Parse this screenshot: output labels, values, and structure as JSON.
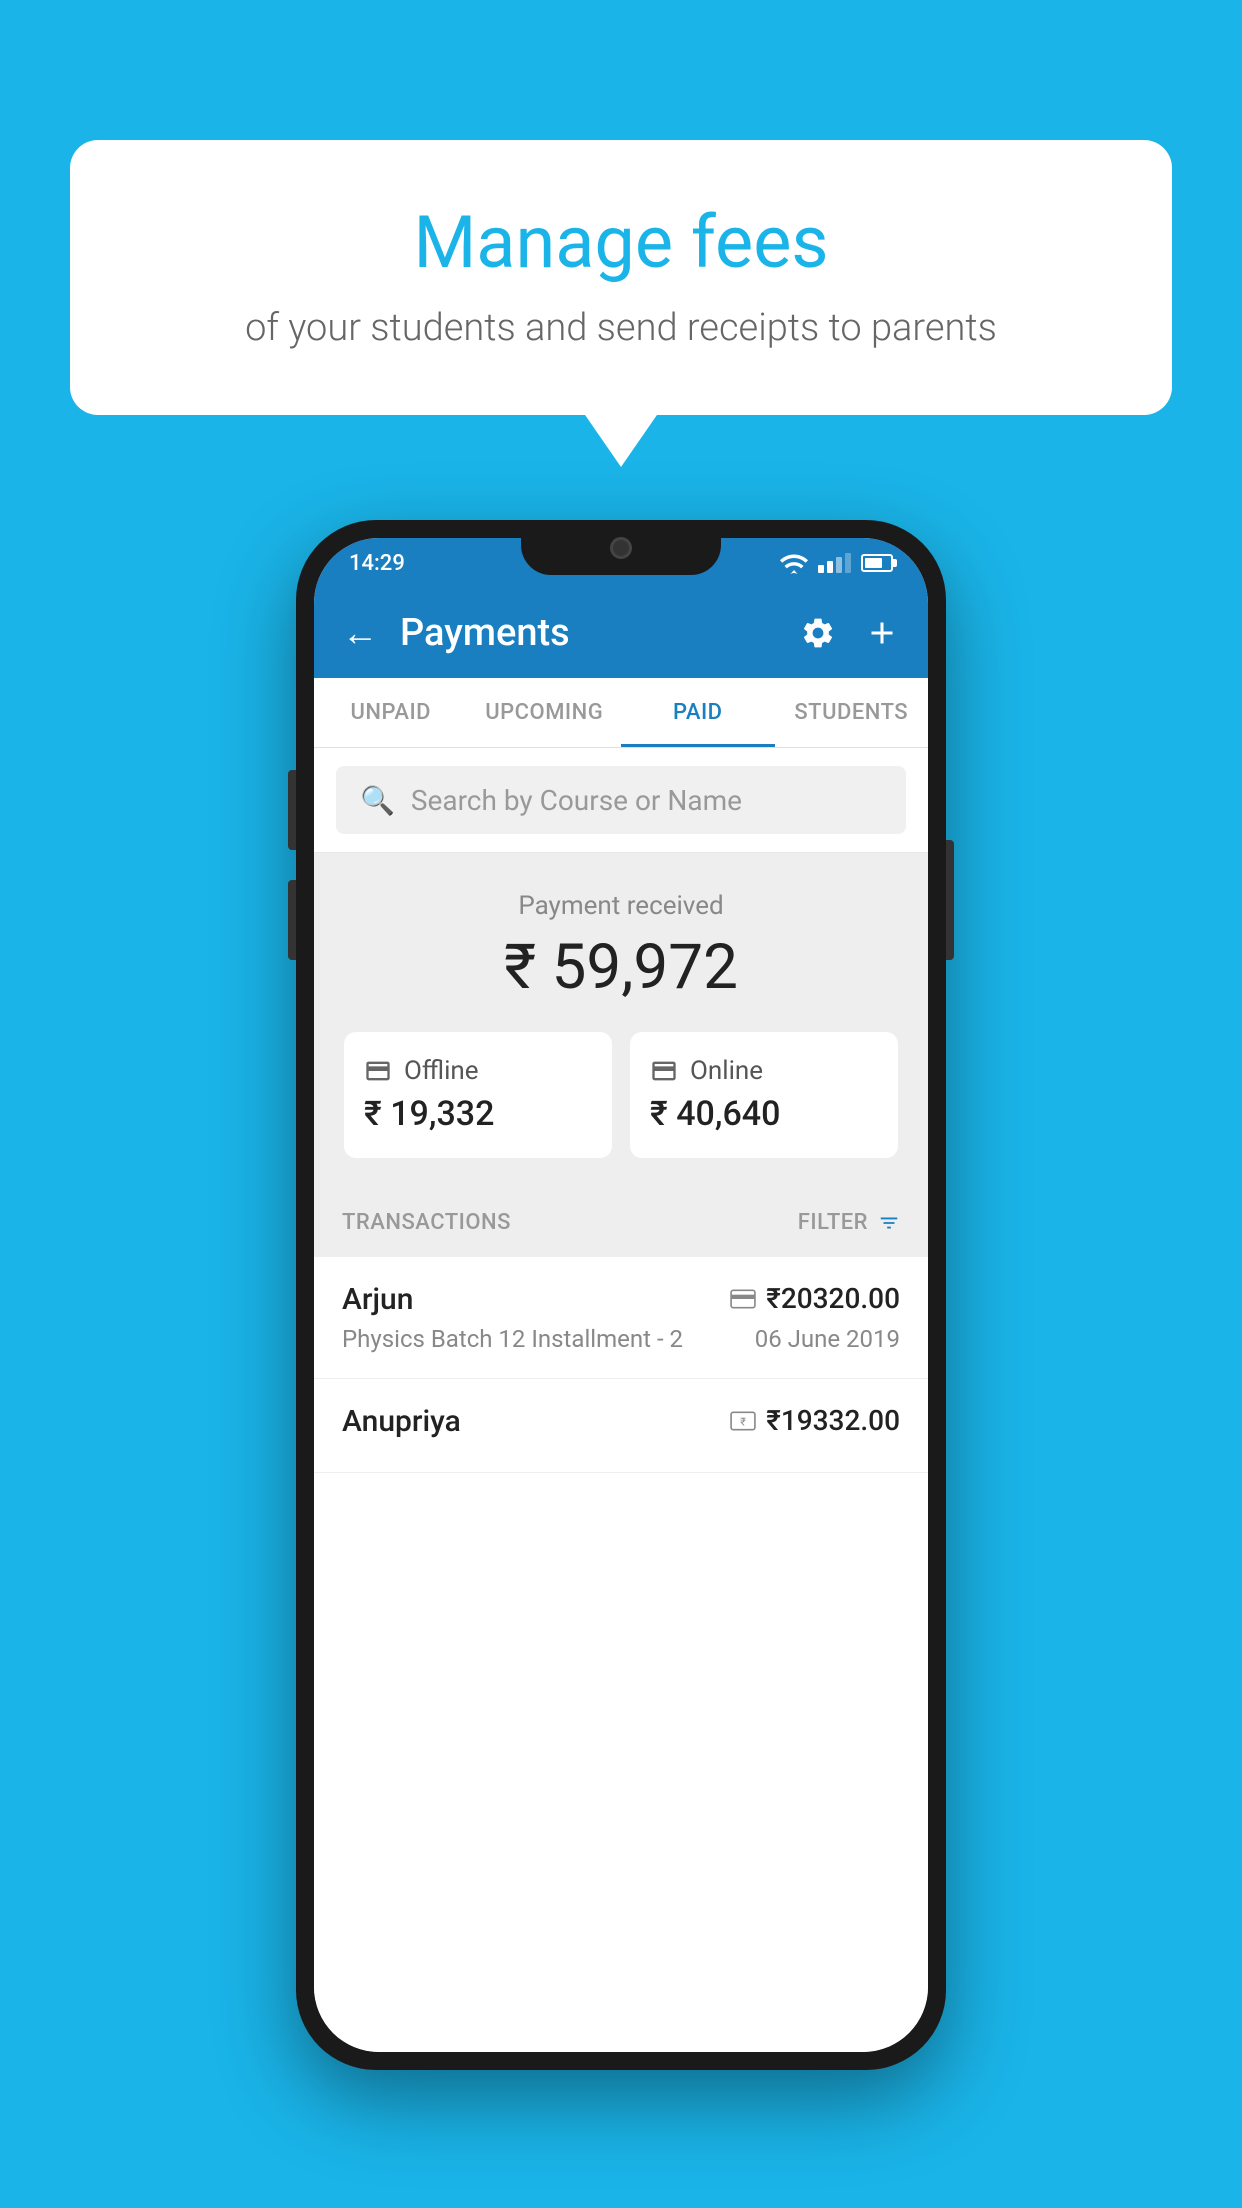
{
  "background_color": "#1ab4e8",
  "speech_bubble": {
    "title": "Manage fees",
    "subtitle": "of your students and send receipts to parents"
  },
  "status_bar": {
    "time": "14:29"
  },
  "toolbar": {
    "title": "Payments",
    "back_label": "←"
  },
  "tabs": [
    {
      "label": "UNPAID",
      "active": false
    },
    {
      "label": "UPCOMING",
      "active": false
    },
    {
      "label": "PAID",
      "active": true
    },
    {
      "label": "STUDENTS",
      "active": false
    }
  ],
  "search": {
    "placeholder": "Search by Course or Name"
  },
  "payment_summary": {
    "received_label": "Payment received",
    "total_amount": "₹ 59,972",
    "offline_label": "Offline",
    "offline_amount": "₹ 19,332",
    "online_label": "Online",
    "online_amount": "₹ 40,640"
  },
  "transactions": {
    "section_label": "TRANSACTIONS",
    "filter_label": "FILTER",
    "items": [
      {
        "name": "Arjun",
        "course": "Physics Batch 12 Installment - 2",
        "amount": "₹20320.00",
        "date": "06 June 2019",
        "payment_type": "online"
      },
      {
        "name": "Anupriya",
        "course": "",
        "amount": "₹19332.00",
        "date": "",
        "payment_type": "offline"
      }
    ]
  }
}
